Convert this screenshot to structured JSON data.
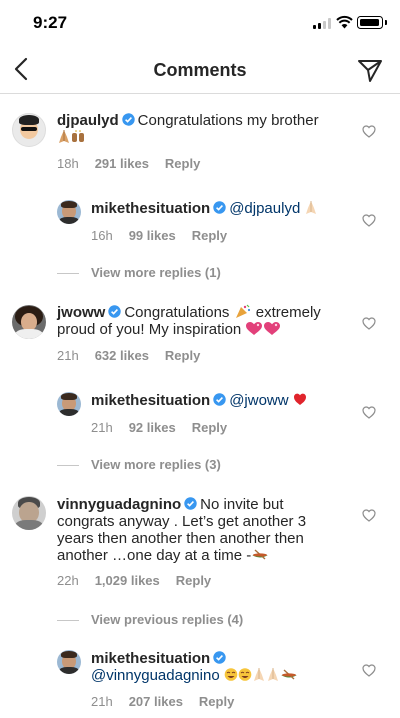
{
  "status_bar": {
    "time": "9:27"
  },
  "header": {
    "title": "Comments"
  },
  "comments": [
    {
      "username": "djpaulyd",
      "text": "Congratulations my brother",
      "time": "18h",
      "likes": "291 likes",
      "reply_label": "Reply",
      "view_replies": "View more replies (1)",
      "reply": {
        "username": "mikethesituation",
        "mention": "@djpaulyd",
        "time": "16h",
        "likes": "99 likes",
        "reply_label": "Reply"
      }
    },
    {
      "username": "jwoww",
      "text_line1": "Congratulations",
      "text_line1b": "extremely",
      "text_line2": "proud of you! My inspiration",
      "time": "21h",
      "likes": "632 likes",
      "reply_label": "Reply",
      "view_replies": "View more replies (3)",
      "reply": {
        "username": "mikethesituation",
        "mention": "@jwoww",
        "time": "21h",
        "likes": "92 likes",
        "reply_label": "Reply"
      }
    },
    {
      "username": "vinnyguadagnino",
      "text_line1": "No invite but",
      "text_line2": "congrats anyway . Let’s get another 3",
      "text_line3": "years then another then another then",
      "text_line4": "another …one day at a time -",
      "time": "22h",
      "likes": "1,029 likes",
      "reply_label": "Reply",
      "view_replies": "View previous replies (4)",
      "reply": {
        "username": "mikethesituation",
        "mention": "@vinnyguadagnino",
        "time": "21h",
        "likes": "207 likes",
        "reply_label": "Reply"
      }
    }
  ]
}
